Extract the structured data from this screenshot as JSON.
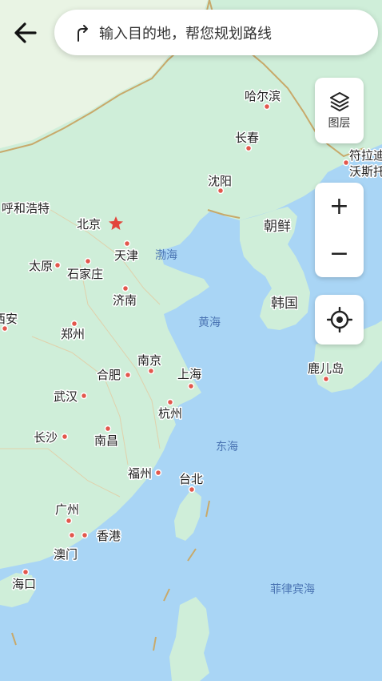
{
  "header": {
    "search_placeholder": "输入目的地，帮您规划路线"
  },
  "controls": {
    "layers_label": "图层",
    "zoom_in_label": "+",
    "zoom_out_label": "−"
  },
  "icons": {
    "back": "back-arrow-icon",
    "route": "route-turn-icon",
    "layers": "layers-icon",
    "locate": "locate-crosshair-icon",
    "capital": "star-icon"
  },
  "colors": {
    "land": "#cfeed9",
    "land_light": "#e9f4e4",
    "sea": "#a9d5f5",
    "border": "#c8a96a",
    "city_dot": "#e2574c",
    "capital_star": "#e2453b"
  },
  "map": {
    "cities": [
      "哈尔滨",
      "长春",
      "沈阳",
      "呼和浩特",
      "北京",
      "天津",
      "太原",
      "石家庄",
      "济南",
      "西安",
      "郑州",
      "南京",
      "合肥",
      "上海",
      "武汉",
      "杭州",
      "长沙",
      "南昌",
      "福州",
      "台北",
      "广州",
      "香港",
      "澳门",
      "海口",
      "鹿儿岛",
      "符拉迪沃斯托克"
    ],
    "countries": [
      "朝鲜",
      "韩国"
    ],
    "seas": [
      "渤海",
      "黄海",
      "东海",
      "菲律宾海"
    ]
  }
}
